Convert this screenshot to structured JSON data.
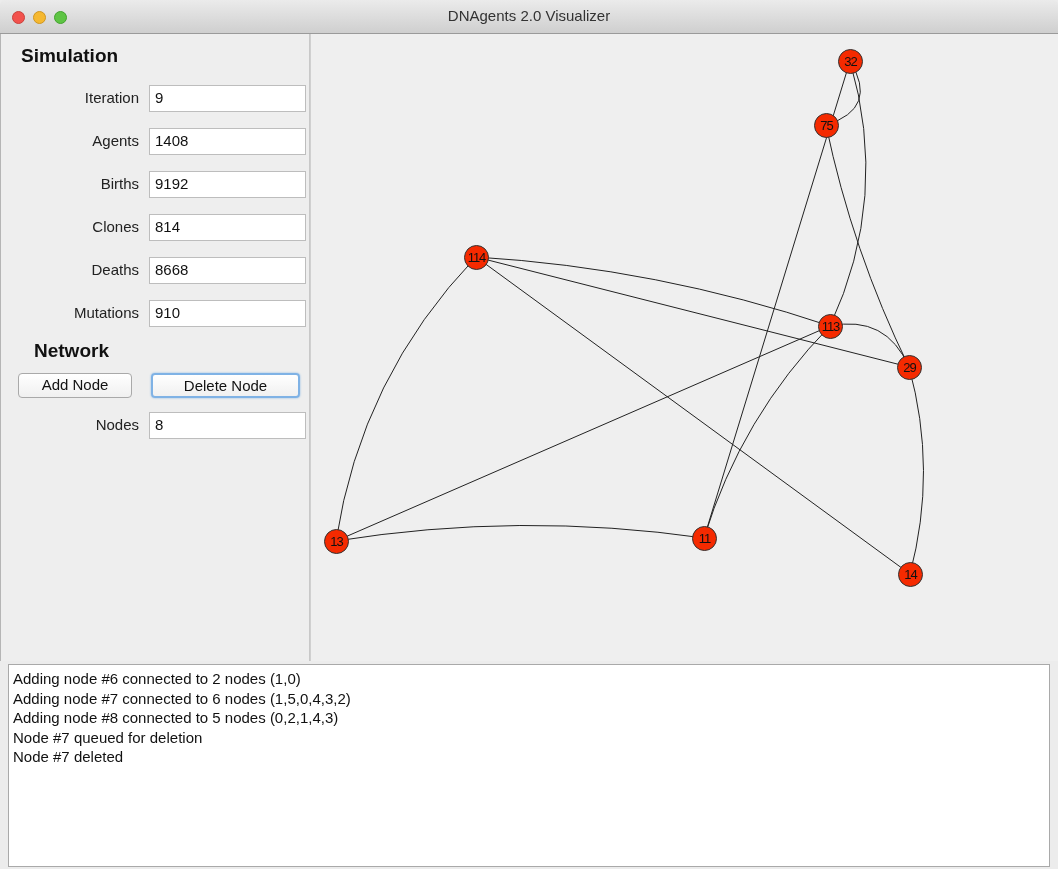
{
  "window": {
    "title": "DNAgents 2.0 Visualizer"
  },
  "simulation": {
    "heading": "Simulation",
    "fields": [
      {
        "label": "Iteration",
        "value": "9"
      },
      {
        "label": "Agents",
        "value": "1408"
      },
      {
        "label": "Births",
        "value": "9192"
      },
      {
        "label": "Clones",
        "value": "814"
      },
      {
        "label": "Deaths",
        "value": "8668"
      },
      {
        "label": "Mutations",
        "value": "910"
      }
    ]
  },
  "network": {
    "heading": "Network",
    "buttons": [
      {
        "label": "Add Node",
        "focused": false
      },
      {
        "label": "Delete Node",
        "focused": true
      }
    ],
    "fields": [
      {
        "label": "Nodes",
        "value": "8"
      }
    ]
  },
  "graph": {
    "nodes": [
      "32",
      "75",
      "114",
      "113",
      "29",
      "13",
      "11",
      "14"
    ]
  },
  "log": [
    "Adding node #6 connected to 2 nodes (1,0)",
    "Adding node #7 connected to 6 nodes (1,5,0,4,3,2)",
    "Adding node #8 connected to 5 nodes (0,2,1,4,3)",
    "Node #7 queued for deletion",
    "Node #7 deleted"
  ]
}
